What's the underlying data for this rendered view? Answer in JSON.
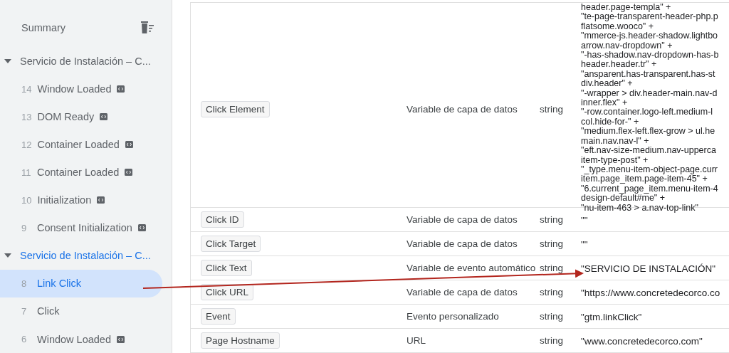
{
  "sidebar": {
    "summary": {
      "label": "Summary"
    },
    "groups": [
      {
        "label": "Servicio de Instalación – C...",
        "expanded": true,
        "selected": false,
        "children": [
          {
            "number": "14",
            "label": "Window Loaded",
            "code_badge": true,
            "selected": false
          },
          {
            "number": "13",
            "label": "DOM Ready",
            "code_badge": true,
            "selected": false
          },
          {
            "number": "12",
            "label": "Container Loaded",
            "code_badge": true,
            "selected": false
          },
          {
            "number": "11",
            "label": "Container Loaded",
            "code_badge": true,
            "selected": false
          },
          {
            "number": "10",
            "label": "Initialization",
            "code_badge": true,
            "selected": false
          },
          {
            "number": "9",
            "label": "Consent Initialization",
            "code_badge": true,
            "selected": false
          }
        ]
      },
      {
        "label": "Servicio de Instalación – C...",
        "expanded": true,
        "selected": true,
        "children": [
          {
            "number": "8",
            "label": "Link Click",
            "code_badge": false,
            "selected": true
          },
          {
            "number": "7",
            "label": "Click",
            "code_badge": false,
            "selected": false
          },
          {
            "number": "6",
            "label": "Window Loaded",
            "code_badge": true,
            "selected": false
          }
        ]
      }
    ]
  },
  "table": {
    "rows": [
      {
        "name": "Click Element",
        "type": "Variable de capa de datos",
        "data_type": "string",
        "value_lines": [
          "header.page-templa\" +",
          "\"te-page-transparent-header-php.p",
          "flatsome.wooco\" +",
          "\"mmerce-js.header-shadow.lightbo",
          "arrow.nav-dropdown\" +",
          "\"-has-shadow.nav-dropdown-has-b",
          "header.header.tr\" +",
          "\"ansparent.has-transparent.has-st",
          "div.header\" +",
          "\"-wrapper > div.header-main.nav-d",
          "inner.flex\" +",
          "\"-row.container.logo-left.medium-l",
          "col.hide-for-\" +",
          "\"medium.flex-left.flex-grow > ul.he",
          "main.nav.nav-l\" +",
          "\"eft.nav-size-medium.nav-upperca",
          "item-type-post\" +",
          "\"_type.menu-item-object-page.curr",
          "item.page_item.page-item-45\" +",
          "\"6.current_page_item.menu-item-4",
          "design-default#me\" +",
          "\"nu-item-463 > a.nav-top-link\""
        ]
      },
      {
        "name": "Click ID",
        "type": "Variable de capa de datos",
        "data_type": "string",
        "value_lines": [
          "\"\""
        ]
      },
      {
        "name": "Click Target",
        "type": "Variable de capa de datos",
        "data_type": "string",
        "value_lines": [
          "\"\""
        ]
      },
      {
        "name": "Click Text",
        "type": "Variable de evento automático",
        "data_type": "string",
        "value_lines": [
          "\"SERVICIO DE INSTALACIÓN\""
        ]
      },
      {
        "name": "Click URL",
        "type": "Variable de capa de datos",
        "data_type": "string",
        "value_lines": [
          "\"https://www.concretedecorco.co"
        ]
      },
      {
        "name": "Event",
        "type": "Evento personalizado",
        "data_type": "string",
        "value_lines": [
          "\"gtm.linkClick\""
        ]
      },
      {
        "name": "Page Hostname",
        "type": "URL",
        "data_type": "string",
        "value_lines": [
          "\"www.concretedecorco.com\""
        ]
      }
    ]
  }
}
